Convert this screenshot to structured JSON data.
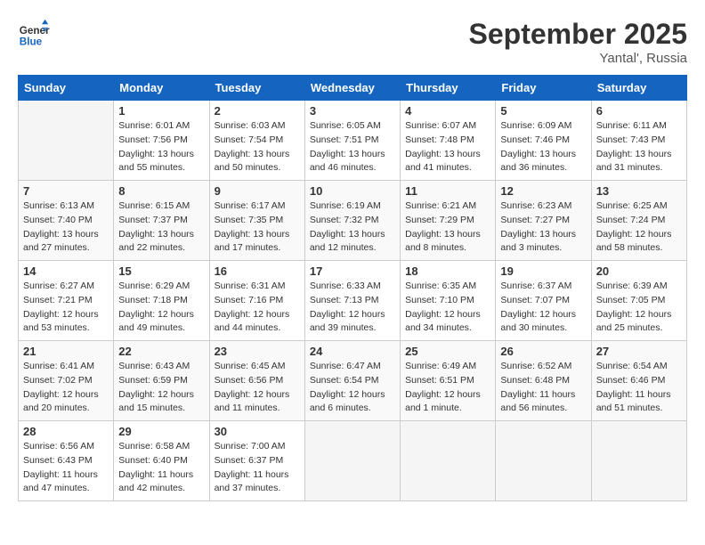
{
  "header": {
    "logo_line1": "General",
    "logo_line2": "Blue",
    "month": "September 2025",
    "location": "Yantal', Russia"
  },
  "days_of_week": [
    "Sunday",
    "Monday",
    "Tuesday",
    "Wednesday",
    "Thursday",
    "Friday",
    "Saturday"
  ],
  "weeks": [
    [
      {
        "day": "",
        "info": ""
      },
      {
        "day": "1",
        "info": "Sunrise: 6:01 AM\nSunset: 7:56 PM\nDaylight: 13 hours\nand 55 minutes."
      },
      {
        "day": "2",
        "info": "Sunrise: 6:03 AM\nSunset: 7:54 PM\nDaylight: 13 hours\nand 50 minutes."
      },
      {
        "day": "3",
        "info": "Sunrise: 6:05 AM\nSunset: 7:51 PM\nDaylight: 13 hours\nand 46 minutes."
      },
      {
        "day": "4",
        "info": "Sunrise: 6:07 AM\nSunset: 7:48 PM\nDaylight: 13 hours\nand 41 minutes."
      },
      {
        "day": "5",
        "info": "Sunrise: 6:09 AM\nSunset: 7:46 PM\nDaylight: 13 hours\nand 36 minutes."
      },
      {
        "day": "6",
        "info": "Sunrise: 6:11 AM\nSunset: 7:43 PM\nDaylight: 13 hours\nand 31 minutes."
      }
    ],
    [
      {
        "day": "7",
        "info": "Sunrise: 6:13 AM\nSunset: 7:40 PM\nDaylight: 13 hours\nand 27 minutes."
      },
      {
        "day": "8",
        "info": "Sunrise: 6:15 AM\nSunset: 7:37 PM\nDaylight: 13 hours\nand 22 minutes."
      },
      {
        "day": "9",
        "info": "Sunrise: 6:17 AM\nSunset: 7:35 PM\nDaylight: 13 hours\nand 17 minutes."
      },
      {
        "day": "10",
        "info": "Sunrise: 6:19 AM\nSunset: 7:32 PM\nDaylight: 13 hours\nand 12 minutes."
      },
      {
        "day": "11",
        "info": "Sunrise: 6:21 AM\nSunset: 7:29 PM\nDaylight: 13 hours\nand 8 minutes."
      },
      {
        "day": "12",
        "info": "Sunrise: 6:23 AM\nSunset: 7:27 PM\nDaylight: 13 hours\nand 3 minutes."
      },
      {
        "day": "13",
        "info": "Sunrise: 6:25 AM\nSunset: 7:24 PM\nDaylight: 12 hours\nand 58 minutes."
      }
    ],
    [
      {
        "day": "14",
        "info": "Sunrise: 6:27 AM\nSunset: 7:21 PM\nDaylight: 12 hours\nand 53 minutes."
      },
      {
        "day": "15",
        "info": "Sunrise: 6:29 AM\nSunset: 7:18 PM\nDaylight: 12 hours\nand 49 minutes."
      },
      {
        "day": "16",
        "info": "Sunrise: 6:31 AM\nSunset: 7:16 PM\nDaylight: 12 hours\nand 44 minutes."
      },
      {
        "day": "17",
        "info": "Sunrise: 6:33 AM\nSunset: 7:13 PM\nDaylight: 12 hours\nand 39 minutes."
      },
      {
        "day": "18",
        "info": "Sunrise: 6:35 AM\nSunset: 7:10 PM\nDaylight: 12 hours\nand 34 minutes."
      },
      {
        "day": "19",
        "info": "Sunrise: 6:37 AM\nSunset: 7:07 PM\nDaylight: 12 hours\nand 30 minutes."
      },
      {
        "day": "20",
        "info": "Sunrise: 6:39 AM\nSunset: 7:05 PM\nDaylight: 12 hours\nand 25 minutes."
      }
    ],
    [
      {
        "day": "21",
        "info": "Sunrise: 6:41 AM\nSunset: 7:02 PM\nDaylight: 12 hours\nand 20 minutes."
      },
      {
        "day": "22",
        "info": "Sunrise: 6:43 AM\nSunset: 6:59 PM\nDaylight: 12 hours\nand 15 minutes."
      },
      {
        "day": "23",
        "info": "Sunrise: 6:45 AM\nSunset: 6:56 PM\nDaylight: 12 hours\nand 11 minutes."
      },
      {
        "day": "24",
        "info": "Sunrise: 6:47 AM\nSunset: 6:54 PM\nDaylight: 12 hours\nand 6 minutes."
      },
      {
        "day": "25",
        "info": "Sunrise: 6:49 AM\nSunset: 6:51 PM\nDaylight: 12 hours\nand 1 minute."
      },
      {
        "day": "26",
        "info": "Sunrise: 6:52 AM\nSunset: 6:48 PM\nDaylight: 11 hours\nand 56 minutes."
      },
      {
        "day": "27",
        "info": "Sunrise: 6:54 AM\nSunset: 6:46 PM\nDaylight: 11 hours\nand 51 minutes."
      }
    ],
    [
      {
        "day": "28",
        "info": "Sunrise: 6:56 AM\nSunset: 6:43 PM\nDaylight: 11 hours\nand 47 minutes."
      },
      {
        "day": "29",
        "info": "Sunrise: 6:58 AM\nSunset: 6:40 PM\nDaylight: 11 hours\nand 42 minutes."
      },
      {
        "day": "30",
        "info": "Sunrise: 7:00 AM\nSunset: 6:37 PM\nDaylight: 11 hours\nand 37 minutes."
      },
      {
        "day": "",
        "info": ""
      },
      {
        "day": "",
        "info": ""
      },
      {
        "day": "",
        "info": ""
      },
      {
        "day": "",
        "info": ""
      }
    ]
  ]
}
